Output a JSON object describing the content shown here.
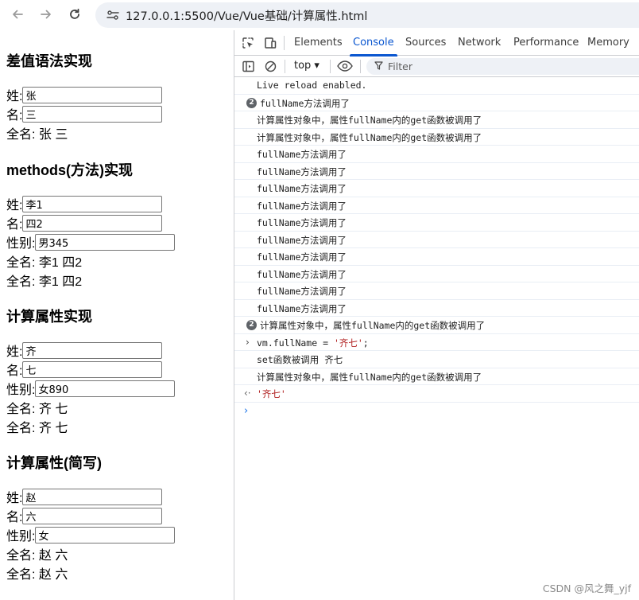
{
  "browser": {
    "url": "127.0.0.1:5500/Vue/Vue基础/计算属性.html"
  },
  "page": {
    "sections": [
      {
        "title": "差值语法实现",
        "fields": [
          {
            "label": "姓:",
            "value": "张"
          },
          {
            "label": "名:",
            "value": "三"
          }
        ],
        "outputs": [
          "全名: 张 三"
        ]
      },
      {
        "title": "methods(方法)实现",
        "fields": [
          {
            "label": "姓:",
            "value": "李1"
          },
          {
            "label": "名:",
            "value": "四2"
          },
          {
            "label": "性别:",
            "value": "男345"
          }
        ],
        "outputs": [
          "全名: 李1 四2",
          "全名: 李1 四2"
        ]
      },
      {
        "title": "计算属性实现",
        "fields": [
          {
            "label": "姓:",
            "value": "齐"
          },
          {
            "label": "名:",
            "value": "七"
          },
          {
            "label": "性别:",
            "value": "女890"
          }
        ],
        "outputs": [
          "全名: 齐 七",
          "全名: 齐 七"
        ]
      },
      {
        "title": "计算属性(简写)",
        "fields": [
          {
            "label": "姓:",
            "value": "赵"
          },
          {
            "label": "名:",
            "value": "六"
          },
          {
            "label": "性别:",
            "value": "女"
          }
        ],
        "outputs": [
          "全名: 赵 六",
          "全名: 赵 六"
        ]
      }
    ]
  },
  "devtools": {
    "tabs": [
      "Elements",
      "Console",
      "Sources",
      "Network",
      "Performance",
      "Memory"
    ],
    "active_tab": "Console",
    "context": "top ▾",
    "filter_placeholder": "Filter",
    "messages": [
      {
        "text": "Live reload enabled.",
        "badge": ""
      },
      {
        "text": "fullName方法调用了",
        "badge": "2"
      },
      {
        "text": "计算属性对象中，属性fullName内的get函数被调用了",
        "badge": ""
      },
      {
        "text": "计算属性对象中，属性fullName内的get函数被调用了",
        "badge": ""
      },
      {
        "text": "fullName方法调用了",
        "badge": ""
      },
      {
        "text": "fullName方法调用了",
        "badge": ""
      },
      {
        "text": "fullName方法调用了",
        "badge": ""
      },
      {
        "text": "fullName方法调用了",
        "badge": ""
      },
      {
        "text": "fullName方法调用了",
        "badge": ""
      },
      {
        "text": "fullName方法调用了",
        "badge": ""
      },
      {
        "text": "fullName方法调用了",
        "badge": ""
      },
      {
        "text": "fullName方法调用了",
        "badge": ""
      },
      {
        "text": "fullName方法调用了",
        "badge": ""
      },
      {
        "text": "fullName方法调用了",
        "badge": ""
      },
      {
        "text": "计算属性对象中，属性fullName内的get函数被调用了",
        "badge": "2"
      }
    ],
    "input_line": {
      "prefix": "vm.fullName = ",
      "string": "'齐七'",
      "suffix": ";"
    },
    "after_messages": [
      "set函数被调用 齐七",
      "计算属性对象中，属性fullName内的get函数被调用了"
    ],
    "result": "'齐七'"
  },
  "watermark": "CSDN @风之舞_yjf",
  "icons": {
    "back": "arrow-left-icon",
    "forward": "arrow-right-icon",
    "reload": "reload-icon",
    "site_info": "site-info-icon",
    "inspect": "inspect-element-icon",
    "device": "device-toolbar-icon",
    "sidebar": "sidebar-toggle-icon",
    "clear": "clear-console-icon",
    "eye": "live-expression-icon",
    "filter": "filter-icon"
  }
}
